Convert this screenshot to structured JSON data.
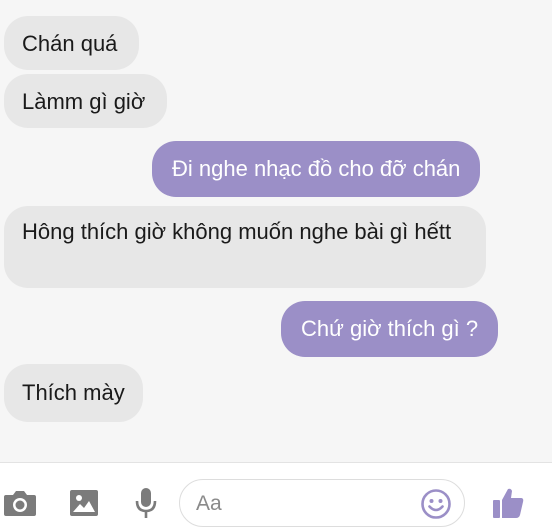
{
  "messages": [
    {
      "direction": "incoming",
      "text": "Chán quá"
    },
    {
      "direction": "incoming",
      "text": "Làmm gì giờ"
    },
    {
      "direction": "outgoing",
      "text": "Đi nghe nhạc đồ cho đỡ chán"
    },
    {
      "direction": "incoming",
      "text": "Hông thích giờ không muốn nghe bài gì hếtt"
    },
    {
      "direction": "outgoing",
      "text": "Chứ giờ thích gì ?"
    },
    {
      "direction": "incoming",
      "text": "Thích mày"
    }
  ],
  "composer": {
    "placeholder": "Aa",
    "icons": [
      "camera-icon",
      "photo-icon",
      "microphone-icon",
      "emoji-icon",
      "thumbs-up-icon"
    ]
  },
  "colors": {
    "outgoing_bubble": "#9b8fc7",
    "incoming_bubble": "#e7e7e7",
    "toolbar_icons": "#7b7b7b",
    "accent": "#9b8fc7"
  }
}
